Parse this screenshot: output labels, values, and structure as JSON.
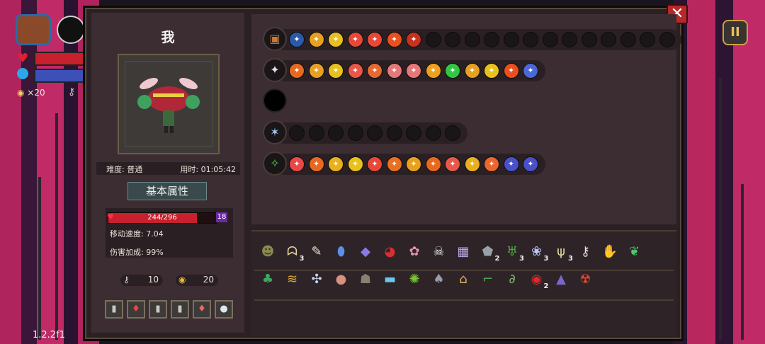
{
  "hud": {
    "coins": "×20",
    "version": "1.2.2f1",
    "pause_glyph": "II",
    "close_glyph": "✕"
  },
  "character": {
    "name": "我",
    "difficulty": "难度: 普通",
    "time": "用时: 01:05:42",
    "section_title": "基本属性",
    "hp_text": "244/296",
    "hp_fraction": 0.824,
    "shield": "18",
    "move_speed": "移动速度: 7.04",
    "damage_bonus": "伤害加成: 99%",
    "keys": "10",
    "gold": "20"
  },
  "potions": [
    {
      "icon": "bottle-icon",
      "glyph": "▮",
      "color": "#c8c8c8"
    },
    {
      "icon": "red-potion-icon",
      "glyph": "♦",
      "color": "#e84848"
    },
    {
      "icon": "bottle-icon",
      "glyph": "▮",
      "color": "#c8c8c8"
    },
    {
      "icon": "bottle-icon",
      "glyph": "▮",
      "color": "#c8c8c8"
    },
    {
      "icon": "red-potion-icon",
      "glyph": "♦",
      "color": "#f06868"
    },
    {
      "icon": "flask-icon",
      "glyph": "●",
      "color": "#dde8f0"
    }
  ],
  "weapon_rows": [
    {
      "weapon_icon": "chest-icon",
      "weapon_glyph": "▣",
      "weapon_color": "#c87a3a",
      "mods": [
        "#2a5aa8",
        "#e8a020",
        "#e8c020",
        "#e84838",
        "#e84838",
        "#e85020",
        "#c83020"
      ],
      "empty": 13
    },
    {
      "weapon_icon": "staff-icon",
      "weapon_glyph": "✦",
      "weapon_color": "#e0e0e0",
      "mods": [
        "#e86820",
        "#e8a020",
        "#e8c020",
        "#e85848",
        "#e86830",
        "#e87878",
        "#e87878",
        "#f0a020",
        "#30c840",
        "#e8a020",
        "#e8c020",
        "#e85020",
        "#4a68d8"
      ],
      "empty": 0
    },
    {
      "weapon_icon": "empty-weapon-icon",
      "weapon_glyph": "",
      "weapon_color": "#000000",
      "mods": [],
      "empty": 0
    },
    {
      "weapon_icon": "scythe-icon",
      "weapon_glyph": "✶",
      "weapon_color": "#a0c8f0",
      "mods": [],
      "empty": 9
    },
    {
      "weapon_icon": "vine-staff-icon",
      "weapon_glyph": "✧",
      "weapon_color": "#60c850",
      "mods": [
        "#e84848",
        "#e86820",
        "#e8b020",
        "#e8c020",
        "#e84838",
        "#e87020",
        "#e8a020",
        "#e86820",
        "#e85848",
        "#e8b020",
        "#e86830",
        "#4a50c8",
        "#4a50c8"
      ],
      "empty": 0
    }
  ],
  "items_row1": [
    {
      "icon": "ghost-mask-icon",
      "glyph": "☻",
      "color": "#8a8a50",
      "count": ""
    },
    {
      "icon": "jaw-icon",
      "glyph": "ᗣ",
      "color": "#e8d8a0",
      "count": "3"
    },
    {
      "icon": "feather-icon",
      "glyph": "✎",
      "color": "#f0e0d0",
      "count": ""
    },
    {
      "icon": "blue-egg-icon",
      "glyph": "⬮",
      "color": "#5a90e8",
      "count": ""
    },
    {
      "icon": "crystal-icon",
      "glyph": "◆",
      "color": "#8a7ae8",
      "count": ""
    },
    {
      "icon": "red-bird-icon",
      "glyph": "◕",
      "color": "#d83030",
      "count": ""
    },
    {
      "icon": "brain-icon",
      "glyph": "✿",
      "color": "#e090b0",
      "count": ""
    },
    {
      "icon": "skull-icon",
      "glyph": "☠",
      "color": "#e8e8f0",
      "count": ""
    },
    {
      "icon": "rune-card-icon",
      "glyph": "▦",
      "color": "#b8a8e8",
      "count": ""
    },
    {
      "icon": "grey-stone-icon",
      "glyph": "⬟",
      "color": "#9aa0a8",
      "count": "2"
    },
    {
      "icon": "green-hide-icon",
      "glyph": "♅",
      "color": "#50a840",
      "count": "3"
    },
    {
      "icon": "lotus-icon",
      "glyph": "❀",
      "color": "#b8c8f8",
      "count": "3"
    },
    {
      "icon": "antler-icon",
      "glyph": "ψ",
      "color": "#e8d8a0",
      "count": "3"
    },
    {
      "icon": "bone-key-icon",
      "glyph": "⚷",
      "color": "#e0e0e0",
      "count": ""
    },
    {
      "icon": "green-claw-icon",
      "glyph": "✋",
      "color": "#40b840",
      "count": ""
    },
    {
      "icon": "leaf-icon",
      "glyph": "❦",
      "color": "#50c870",
      "count": ""
    }
  ],
  "items_row2": [
    {
      "icon": "clover-icon",
      "glyph": "♣",
      "color": "#40a860",
      "count": ""
    },
    {
      "icon": "gold-scroll-icon",
      "glyph": "≋",
      "color": "#d8a830",
      "count": ""
    },
    {
      "icon": "dragonfly-icon",
      "glyph": "✣",
      "color": "#c8d8f0",
      "count": ""
    },
    {
      "icon": "flesh-orb-icon",
      "glyph": "●",
      "color": "#d89080",
      "count": ""
    },
    {
      "icon": "dark-cape-icon",
      "glyph": "☗",
      "color": "#8a8070",
      "count": ""
    },
    {
      "icon": "battery-icon",
      "glyph": "▬",
      "color": "#68c8f0",
      "count": ""
    },
    {
      "icon": "green-gem-icon",
      "glyph": "✺",
      "color": "#80c040",
      "count": ""
    },
    {
      "icon": "hooded-figure-icon",
      "glyph": "♠",
      "color": "#9a9aa8",
      "count": ""
    },
    {
      "icon": "lantern-icon",
      "glyph": "⌂",
      "color": "#d8b060",
      "count": ""
    },
    {
      "icon": "boot-icon",
      "glyph": "⌐",
      "color": "#50a850",
      "count": ""
    },
    {
      "icon": "hook-icon",
      "glyph": "∂",
      "color": "#80b870",
      "count": ""
    },
    {
      "icon": "red-orb-icon",
      "glyph": "◉",
      "color": "#e02828",
      "count": "2"
    },
    {
      "icon": "robe-icon",
      "glyph": "▲",
      "color": "#7868c8",
      "count": ""
    },
    {
      "icon": "demon-head-icon",
      "glyph": "☢",
      "color": "#e04830",
      "count": ""
    }
  ]
}
